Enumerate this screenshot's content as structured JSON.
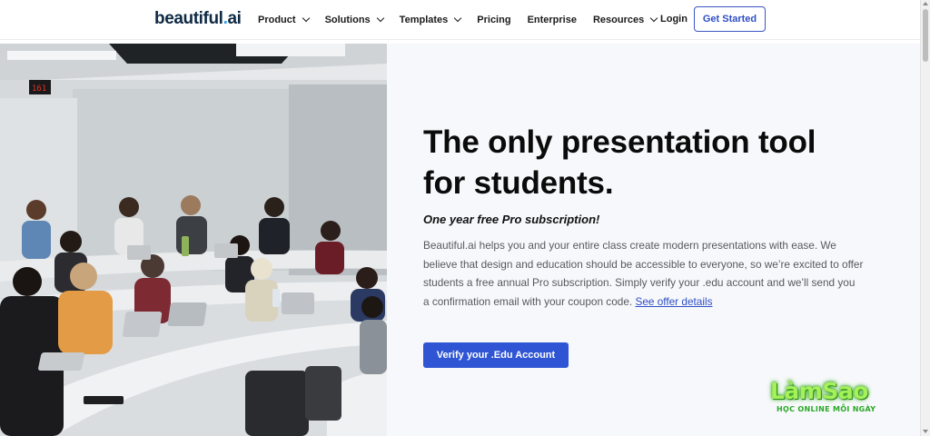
{
  "header": {
    "logo_text": "beautiful",
    "logo_dot": ".",
    "logo_suffix": "ai",
    "nav": [
      {
        "label": "Product",
        "dropdown": true
      },
      {
        "label": "Solutions",
        "dropdown": true
      },
      {
        "label": "Templates",
        "dropdown": true
      },
      {
        "label": "Pricing",
        "dropdown": false
      },
      {
        "label": "Enterprise",
        "dropdown": false
      },
      {
        "label": "Resources",
        "dropdown": true
      }
    ],
    "login_label": "Login",
    "cta_label": "Get Started"
  },
  "hero": {
    "headline_line1": "The only presentation tool",
    "headline_line2": "for students.",
    "subhead": "One year free Pro subscription!",
    "body": "Beautiful.ai helps you and your entire class create modern presentations with ease. We believe that design and education should be accessible to everyone, so we’re excited to offer students a free annual Pro subscription. Simply verify your .edu account and we’ll send you a confirmation email with your coupon code.",
    "link_label": "See offer details",
    "button_label": "Verify your .Edu Account"
  },
  "image": {
    "alt": "students in a lecture hall with laptops",
    "room_sign": "161"
  },
  "watermark": {
    "title": "LàmSao",
    "subtitle": "HỌC ONLINE MỖI NGÀY"
  },
  "colors": {
    "brand_blue": "#2f55d4",
    "logo_navy": "#0f2a44",
    "logo_dot": "#2e9df1",
    "hero_bg": "#f7f8fb"
  }
}
